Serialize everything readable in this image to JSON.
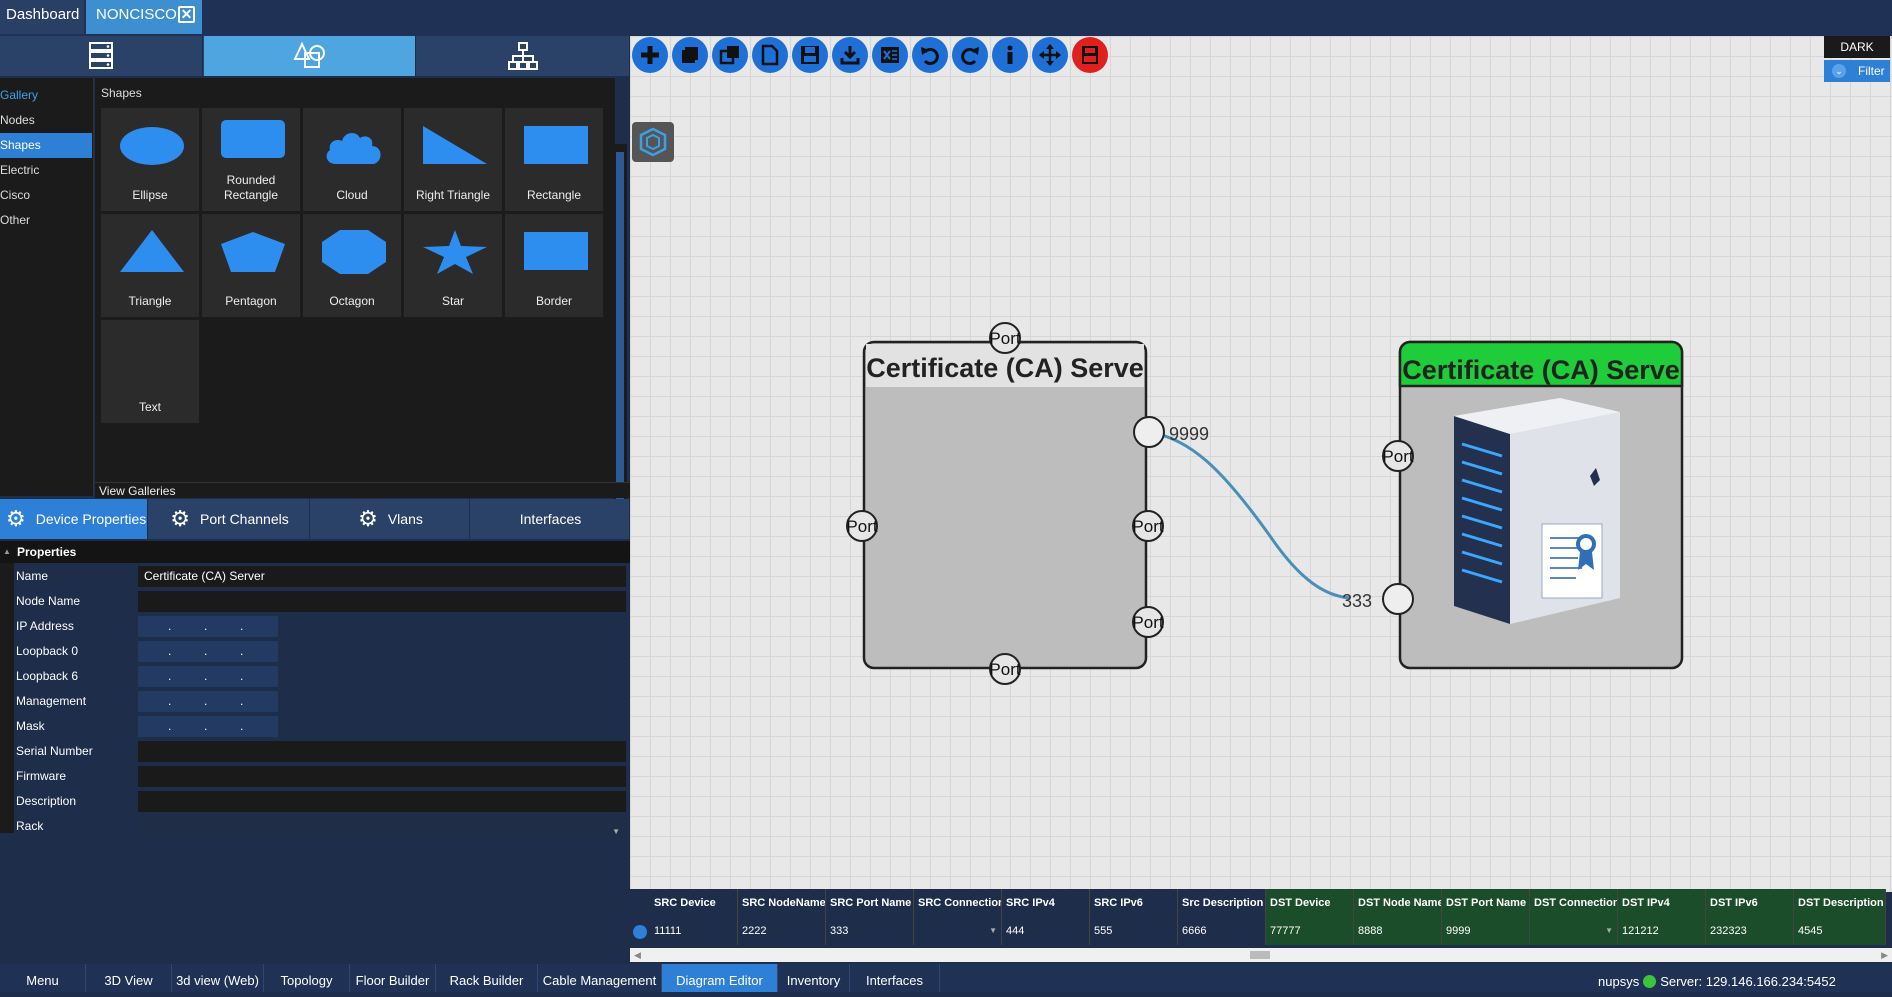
{
  "tabs": {
    "dashboard": "Dashboard",
    "noncisco": "NONCISCO",
    "close": "✕"
  },
  "gallery": {
    "heading": "Gallery",
    "nav": [
      "Nodes",
      "Shapes",
      "Electric",
      "Cisco",
      "Other"
    ],
    "selected": "Shapes",
    "title": "Shapes",
    "shapes": [
      "Ellipse",
      "Rounded Rectangle",
      "Cloud",
      "Right Triangle",
      "Rectangle",
      "Triangle",
      "Pentagon",
      "Octagon",
      "Star",
      "Border",
      "Text"
    ],
    "view_galleries": "View Galleries"
  },
  "prop_tabs": {
    "device": "Device Properties",
    "port_channels": "Port Channels",
    "vlans": "Vlans",
    "interfaces": "Interfaces"
  },
  "properties": {
    "header": "Properties",
    "rows": [
      {
        "label": "Name",
        "value": "Certificate (CA) Server"
      },
      {
        "label": "Node Name",
        "value": ""
      },
      {
        "label": "IP Address",
        "value": ". . ."
      },
      {
        "label": "Loopback 0",
        "value": ". . ."
      },
      {
        "label": "Loopback 6",
        "value": ". . ."
      },
      {
        "label": "Management",
        "value": ". . ."
      },
      {
        "label": "Mask",
        "value": ". . ."
      },
      {
        "label": "Serial Number",
        "value": ""
      },
      {
        "label": "Firmware",
        "value": ""
      },
      {
        "label": "Description",
        "value": ""
      },
      {
        "label": "Rack",
        "value": ""
      }
    ]
  },
  "toolbar": {
    "icons": [
      "add-icon",
      "copy-icon",
      "duplicate-icon",
      "new-page-icon",
      "save-icon",
      "download-icon",
      "excel-icon",
      "undo-icon",
      "redo-icon",
      "info-icon",
      "move-icon",
      "delete-icon"
    ]
  },
  "theme": {
    "dark": "DARK",
    "filter": "Filter"
  },
  "diagram": {
    "node1_title": "Certificate (CA) Serve",
    "node2_title": "Certificate (CA) Serve",
    "port_label": "Port",
    "link_src_label": "9999",
    "link_dst_label": "333",
    "colors": {
      "node2_header": "#1fcc3a",
      "link": "#4a8fb8"
    }
  },
  "grid": {
    "headers": [
      "SRC Device",
      "SRC NodeName",
      "SRC Port Name",
      "SRC Connection",
      "SRC IPv4",
      "SRC IPv6",
      "Src Description",
      "DST Device",
      "DST Node Name",
      "DST Port Name",
      "DST Connection",
      "DST IPv4",
      "DST IPv6",
      "DST Description"
    ],
    "row": [
      "11111",
      "2222",
      "333",
      "",
      "444",
      "555",
      "6666",
      "77777",
      "8888",
      "9999",
      "",
      "121212",
      "232323",
      "4545"
    ]
  },
  "bottom_nav": {
    "items": [
      "Menu",
      "3D View",
      "3d view (Web)",
      "Topology",
      "Floor Builder",
      "Rack Builder",
      "Cable Management",
      "Diagram Editor",
      "Inventory",
      "Interfaces"
    ],
    "selected": "Diagram Editor"
  },
  "status": {
    "user": "nupsys",
    "server": "Server: 129.146.166.234:5452"
  }
}
